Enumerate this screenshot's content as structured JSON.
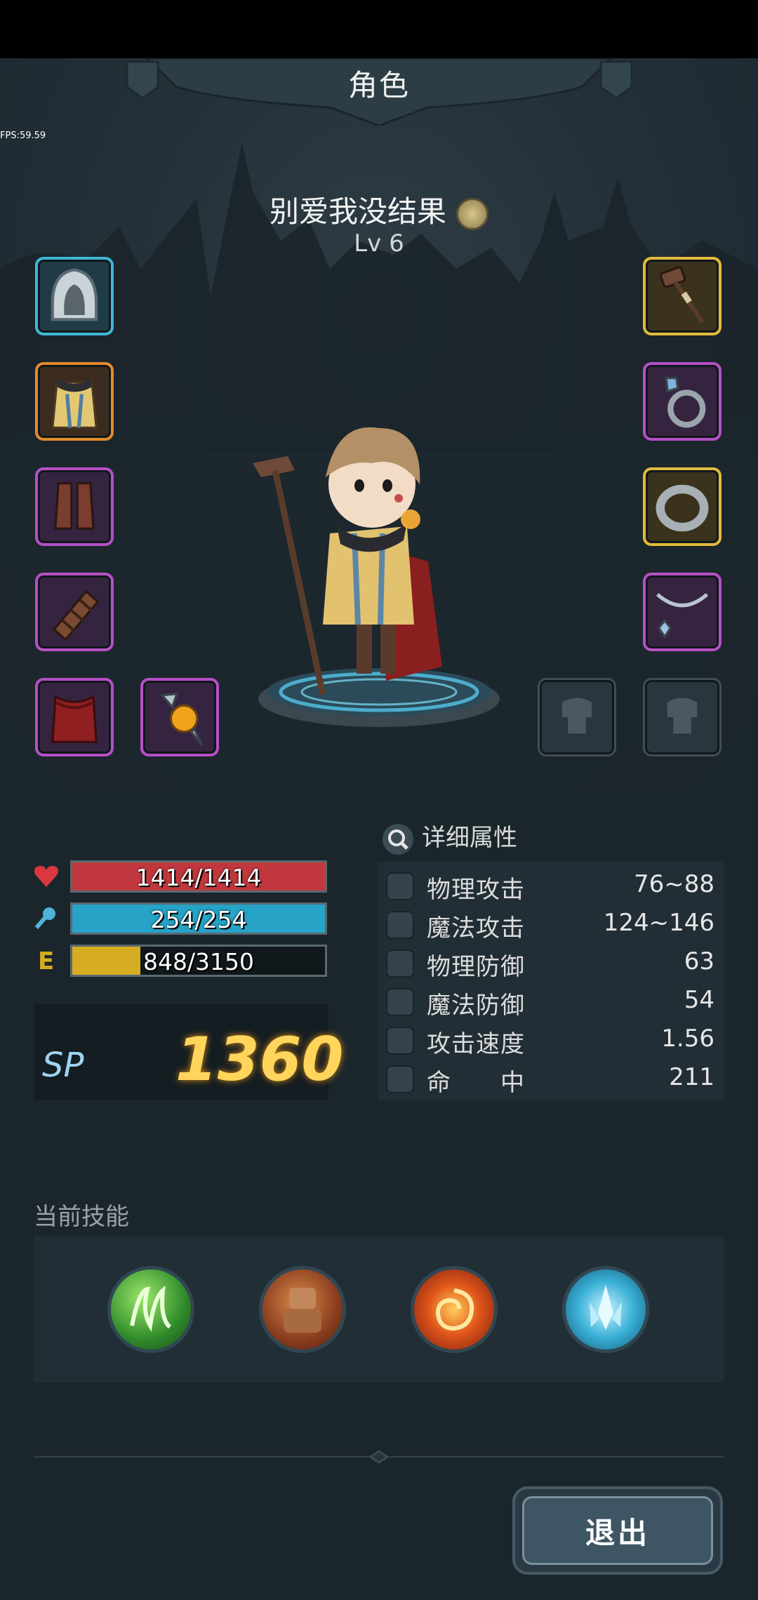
{
  "header": {
    "title": "角色",
    "fps": "FPS:59.59"
  },
  "character": {
    "name": "别爱我没结果",
    "level": "Lv 6"
  },
  "equipment": {
    "left": [
      {
        "name": "hood",
        "rarity": "blue"
      },
      {
        "name": "tunic",
        "rarity": "orange"
      },
      {
        "name": "boots",
        "rarity": "purple"
      },
      {
        "name": "bracer",
        "rarity": "purple"
      },
      {
        "name": "cape",
        "rarity": "purple"
      },
      {
        "name": "gem-pendant",
        "rarity": "purple"
      }
    ],
    "right": [
      {
        "name": "staff",
        "rarity": "gold"
      },
      {
        "name": "gem-ring",
        "rarity": "purple"
      },
      {
        "name": "band-ring",
        "rarity": "gold"
      },
      {
        "name": "necklace",
        "rarity": "purple"
      },
      {
        "name": "locked-slot",
        "rarity": "empty"
      },
      {
        "name": "locked-slot",
        "rarity": "empty"
      }
    ]
  },
  "resources": {
    "hp": {
      "text": "1414/1414",
      "fraction": 1.0,
      "color": "#c0383d"
    },
    "mp": {
      "text": "254/254",
      "fraction": 1.0,
      "color": "#26a3c7"
    },
    "exp": {
      "label": "E",
      "text": "848/3150",
      "fraction": 0.269,
      "color": "#d6ad22"
    }
  },
  "sp": {
    "label": "SP",
    "value": "1360"
  },
  "details": {
    "title": "详细属性",
    "stats": [
      {
        "label": "物理攻击",
        "value": "76~88",
        "icon": "sword-icon"
      },
      {
        "label": "魔法攻击",
        "value": "124~146",
        "icon": "wand-icon"
      },
      {
        "label": "物理防御",
        "value": "63",
        "icon": "shield-icon"
      },
      {
        "label": "魔法防御",
        "value": "54",
        "icon": "magic-shield-icon"
      },
      {
        "label": "攻击速度",
        "value": "1.56",
        "icon": "speed-icon"
      },
      {
        "label": "命　　中",
        "value": "211",
        "icon": "target-icon"
      }
    ]
  },
  "skills": {
    "title": "当前技能",
    "items": [
      {
        "name": "wind-skill",
        "color": "#3fae3a"
      },
      {
        "name": "stone-golem-skill",
        "color": "#b5602c"
      },
      {
        "name": "fire-vortex-skill",
        "color": "#d9541c"
      },
      {
        "name": "ice-crystal-skill",
        "color": "#2e96b8"
      }
    ]
  },
  "footer": {
    "exit_label": "退出"
  }
}
